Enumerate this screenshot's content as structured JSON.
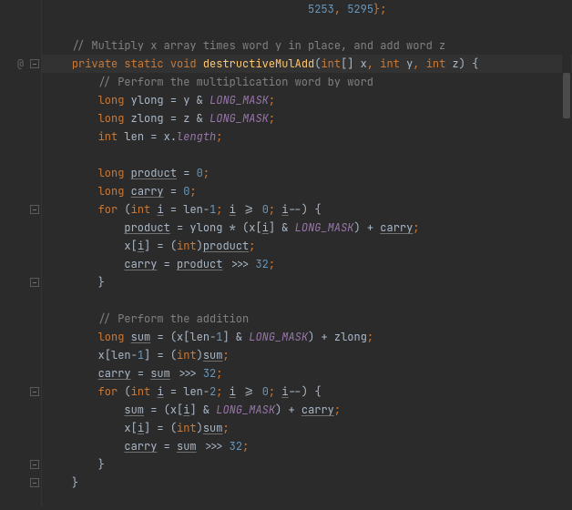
{
  "gutter": {
    "change_badge": "@"
  },
  "colors": {
    "bg": "#2b2b2b",
    "fg": "#a9b7c6",
    "keyword": "#cc7832",
    "number": "#6897bb",
    "comment": "#808080",
    "field": "#9876aa",
    "method": "#ffc66d",
    "caret_line": "#323232"
  },
  "code": {
    "l0_a": "5253",
    "l0_b": "5295",
    "c1": "// Multiply x array times word y in place, and add word z",
    "kw_private": "private",
    "kw_static": "static",
    "kw_void": "void",
    "fn": "destructiveMulAdd",
    "kw_int": "int",
    "br_open": "[]",
    "p_x": "x",
    "p_y": "y",
    "p_z": "z",
    "c2": "// Perform the multiplication word by word",
    "kw_long": "long",
    "v_ylong": "ylong",
    "eq": "=",
    "amp": "&",
    "LONG_MASK": "LONG_MASK",
    "semi": ";",
    "v_zlong": "zlong",
    "v_len": "len",
    "dot": ".",
    "length": "length",
    "v_product": "product",
    "zero": "0",
    "v_carry": "carry",
    "kw_for": "for",
    "v_i": "i",
    "one": "1",
    "two": "2",
    "ge": ">=",
    "dec": "--",
    "star": "*",
    "plus": "+",
    "comma": ",",
    "lparen": "(",
    "rparen": ")",
    "lbrk": "[",
    "rbrk": "]",
    "lbrace": "{",
    "rbrace": "}",
    "cast_int": "int",
    "ushr": ">>>",
    "n32": "32",
    "c3": "// Perform the addition",
    "v_sum": "sum",
    "minus": "-"
  }
}
